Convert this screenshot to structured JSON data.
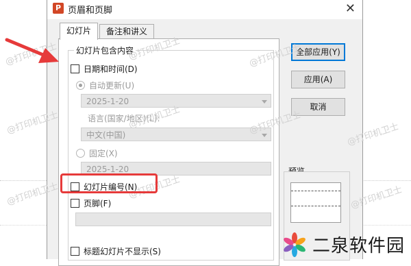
{
  "window": {
    "title": "页眉和页脚",
    "app_icon": "P",
    "close": "✕"
  },
  "tabs": [
    {
      "label": "幻灯片",
      "active": true
    },
    {
      "label": "备注和讲义",
      "active": false
    }
  ],
  "group": {
    "title": "幻灯片包含内容",
    "date_time": {
      "label": "日期和时间(D)",
      "checked": false
    },
    "auto_update": {
      "label": "自动更新(U)",
      "selected": true
    },
    "auto_date_value": "2025-1-20",
    "language_label": "语言(国家/地区)(L):",
    "language_value": "中文(中国)",
    "fixed": {
      "label": "固定(X)",
      "selected": false
    },
    "fixed_date_value": "2025-1-20",
    "slide_number": {
      "label": "幻灯片编号(N)",
      "checked": false
    },
    "footer": {
      "label": "页脚(F)",
      "checked": false,
      "value": ""
    }
  },
  "title_slide": {
    "label": "标题幻灯片不显示(S)",
    "checked": false
  },
  "buttons": {
    "apply_all": "全部应用(Y)",
    "apply": "应用(A)",
    "cancel": "取消"
  },
  "preview": {
    "label": "预览"
  },
  "watermarks": [
    "@打印机卫士",
    "@打印机卫士",
    "@打印机卫士",
    "@打印机卫士",
    "@打印机卫士",
    "@打印机卫士",
    "@打印机卫士",
    "@打印机卫士",
    "@打印机卫士",
    "@打印机卫士"
  ],
  "logo": {
    "text": "二泉软件园"
  },
  "colors": {
    "annotation_red": "#e63a3a",
    "accent_blue": "#0078d7",
    "logo_petals": [
      "#e94b3c",
      "#f7a21b",
      "#2bb673",
      "#27a9e1",
      "#8b5fbf",
      "#e94b8a"
    ]
  }
}
